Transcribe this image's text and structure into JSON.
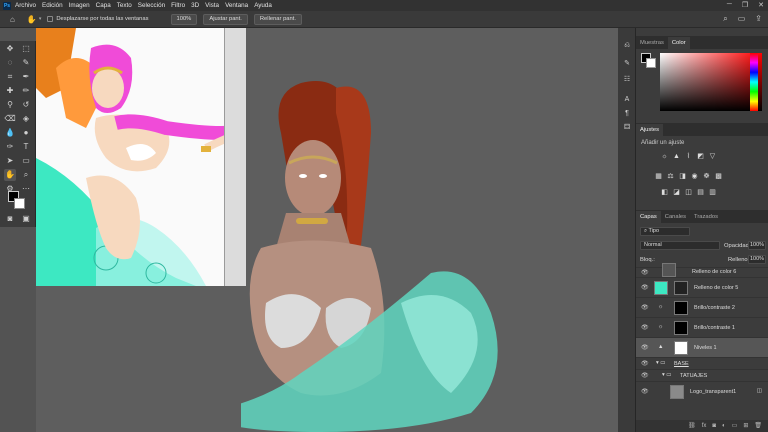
{
  "menu": [
    "Archivo",
    "Edición",
    "Imagen",
    "Capa",
    "Texto",
    "Selección",
    "Filtro",
    "3D",
    "Vista",
    "Ventana",
    "Ayuda"
  ],
  "options": {
    "scroll_all_label": "Desplazarse por todas las ventanas",
    "zoom_button": "100%",
    "fit_button": "Ajustar pant.",
    "fill_button": "Rellenar pant."
  },
  "panels": {
    "color_tabs": [
      "Muestras",
      "Color"
    ],
    "adjust_tab": "Ajustes",
    "adjust_title": "Añadir un ajuste",
    "layer_tabs": [
      "Capas",
      "Canales",
      "Trazados"
    ],
    "filter_kind": "Tipo",
    "blend_mode": "Normal",
    "opacity_label": "Opacidad:",
    "opacity_value": "100%",
    "lock_label": "Bloq.:",
    "fill_label": "Relleno:",
    "fill_value": "100%"
  },
  "layers": [
    {
      "name": "Relleno de color 6",
      "thumb": "#555555",
      "selected": false
    },
    {
      "name": "Relleno de color 5",
      "thumb": "#3de8c2",
      "selected": false
    },
    {
      "name": "Brillo/contraste 2",
      "thumb": "#000000",
      "selected": false
    },
    {
      "name": "Brillo/contraste 1",
      "thumb": "#000000",
      "selected": false
    },
    {
      "name": "Niveles 1",
      "thumb": "#ffffff",
      "selected": true
    },
    {
      "name": "BASE",
      "thumb": "",
      "selected": false
    },
    {
      "name": "TATUAJES",
      "thumb": "",
      "selected": false
    },
    {
      "name": "Logo_transparent1",
      "thumb": "#8a8a8a",
      "selected": false
    }
  ],
  "colors": {
    "accent": "#31a8ff",
    "teal": "#3de8c2",
    "magenta": "#f04bd8"
  }
}
